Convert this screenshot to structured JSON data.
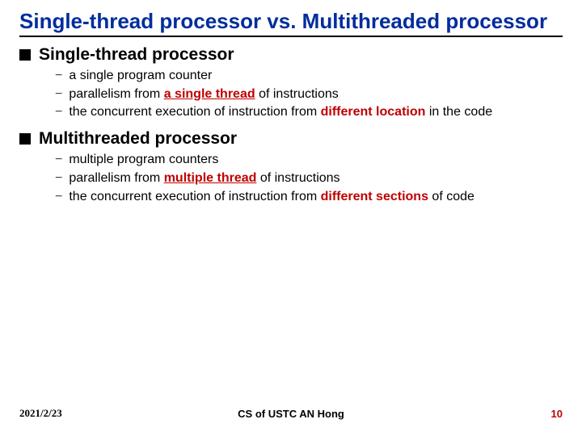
{
  "title": "Single-thread processor vs. Multithreaded processor",
  "sections": [
    {
      "heading": "Single-thread processor",
      "items": [
        {
          "parts": [
            {
              "t": "a single program counter"
            }
          ]
        },
        {
          "parts": [
            {
              "t": "parallelism from "
            },
            {
              "t": "a single thread",
              "cls": "redbold uline"
            },
            {
              "t": " of instructions"
            }
          ]
        },
        {
          "parts": [
            {
              "t": "the concurrent execution of instruction from "
            },
            {
              "t": "different location",
              "cls": "redbold"
            },
            {
              "t": " in the code"
            }
          ]
        }
      ]
    },
    {
      "heading": "Multithreaded processor",
      "items": [
        {
          "parts": [
            {
              "t": "multiple program counters"
            }
          ]
        },
        {
          "parts": [
            {
              "t": "parallelism from "
            },
            {
              "t": "multiple thread",
              "cls": "redbold uline"
            },
            {
              "t": " of instructions"
            }
          ]
        },
        {
          "parts": [
            {
              "t": "the concurrent execution of instruction from "
            },
            {
              "t": "different sections",
              "cls": "redbold"
            },
            {
              "t": " of code"
            }
          ]
        }
      ]
    }
  ],
  "footer": {
    "date": "2021/2/23",
    "center": "CS of USTC AN Hong",
    "page": "10"
  }
}
